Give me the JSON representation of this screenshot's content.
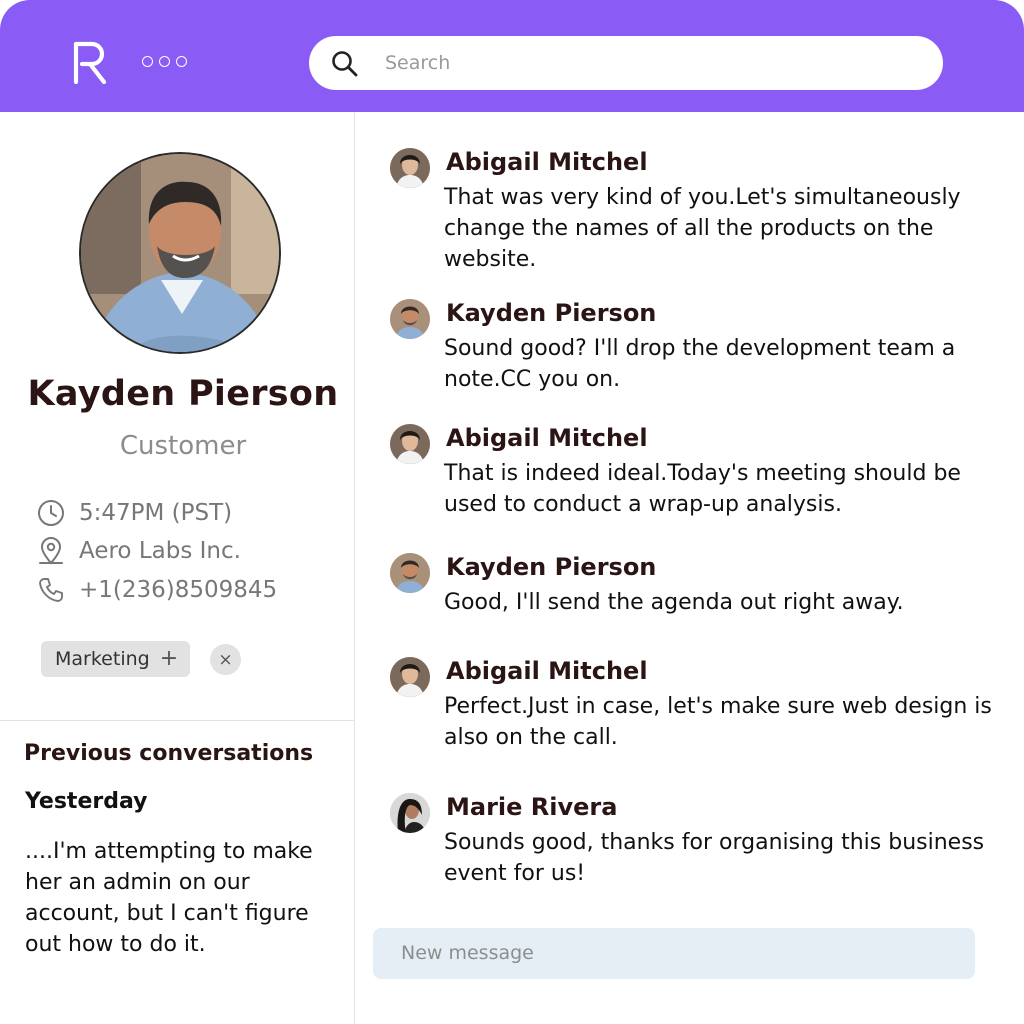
{
  "header": {
    "logo_text": "R",
    "search_placeholder": "Search"
  },
  "profile": {
    "name": "Kayden Pierson",
    "role": "Customer",
    "time": "5:47PM (PST)",
    "company": "Aero Labs Inc.",
    "phone": "+1(236)8509845",
    "tag": "Marketing",
    "tag_plus": "+",
    "tag_close": "×"
  },
  "previous": {
    "title": "Previous conversations",
    "day": "Yesterday",
    "snippet": "....I'm attempting to make her an admin on our account, but I can't figure out how to do it."
  },
  "messages": [
    {
      "sender": "Abigail Mitchel",
      "text": "That was very kind of you.Let's simultaneously change the names of all the products on the website."
    },
    {
      "sender": "Kayden Pierson",
      "text": "Sound good? I'll drop the development team a note.CC you on."
    },
    {
      "sender": "Abigail Mitchel",
      "text": "That is indeed ideal.Today's meeting should be used to conduct a wrap-up analysis."
    },
    {
      "sender": "Kayden Pierson",
      "text": "Good, I'll send the agenda out right away."
    },
    {
      "sender": "Abigail Mitchel",
      "text": "Perfect.Just in case, let's make sure web design is also on the call."
    },
    {
      "sender": "Marie Rivera",
      "text": "Sounds good, thanks for organising this business event for us!"
    }
  ],
  "composer": {
    "placeholder": "New message"
  },
  "colors": {
    "accent": "#8a5cf5",
    "name_text": "#2a1414",
    "muted_text": "#8c8c8c",
    "composer_bg": "#e4eef4",
    "tag_bg": "#e2e2e2"
  }
}
